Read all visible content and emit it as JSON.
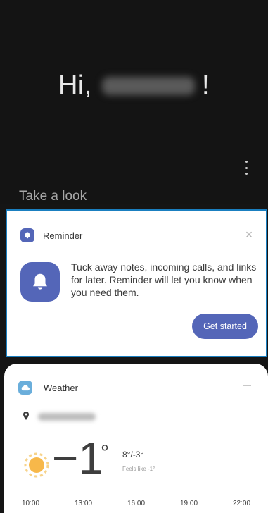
{
  "greeting": {
    "hi": "Hi,",
    "exclamation": "!",
    "section_label": "Take a look"
  },
  "reminder": {
    "title": "Reminder",
    "close": "×",
    "message": "Tuck away notes, incoming calls, and links for later. Reminder will let you know when you need them.",
    "button": "Get started"
  },
  "weather": {
    "title": "Weather",
    "temperature": "−1",
    "degree": "°",
    "range": "8°/-3°",
    "feels_like": "Feels like -1°",
    "hours": [
      "10:00",
      "13:00",
      "16:00",
      "19:00",
      "22:00"
    ]
  },
  "colors": {
    "accent": "#5466b8",
    "weather_icon": "#6aaedb",
    "sun": "#f7b84a",
    "highlight_border": "#1a7fc0"
  }
}
